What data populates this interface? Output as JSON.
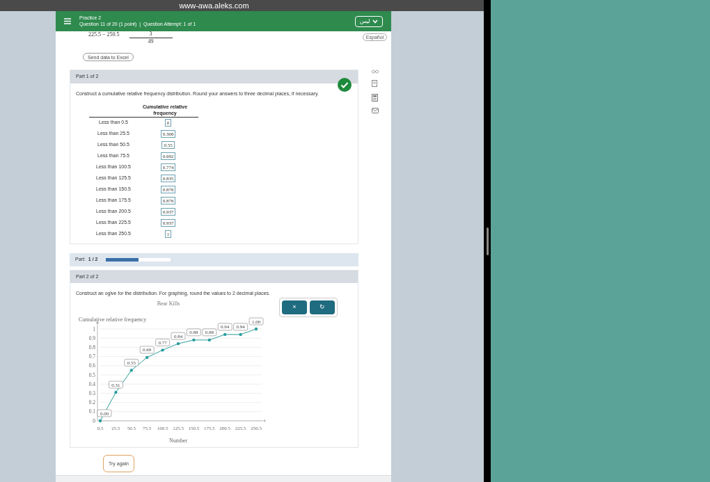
{
  "browser": {
    "url": "www-awa.aleks.com"
  },
  "header": {
    "title": "Practice 2",
    "subtitle": "Question 11 of 20 (1 point)  |  Question Attempt: 1 of 1",
    "language": "ليس"
  },
  "language_button": "Español",
  "previous": {
    "range": "225.5 − 250.5",
    "numerator": "3",
    "denominator": "49"
  },
  "excel_button": "Send data to Excel",
  "part1": {
    "title": "Part 1 of 2",
    "correct": true,
    "instruction": "Construct a cumulative relative frequency distribution. Round your answers to three decimal places, if necessary.",
    "column_header": "Cumulative relative frequency",
    "rows": [
      {
        "label": "Less than 0.5",
        "value": "0"
      },
      {
        "label": "Less than 25.5",
        "value": "0.306"
      },
      {
        "label": "Less than 50.5",
        "value": "0.55"
      },
      {
        "label": "Less than 75.5",
        "value": "0.692"
      },
      {
        "label": "Less than 100.5",
        "value": "0.774"
      },
      {
        "label": "Less than 125.5",
        "value": "0.835"
      },
      {
        "label": "Less than 150.5",
        "value": "0.876"
      },
      {
        "label": "Less than 175.5",
        "value": "0.876"
      },
      {
        "label": "Less than 200.5",
        "value": "0.937"
      },
      {
        "label": "Less than 225.5",
        "value": "0.937"
      },
      {
        "label": "Less than 250.5",
        "value": "1"
      }
    ]
  },
  "progress": {
    "label": "Part:",
    "value": "1 / 2",
    "level": 0.5
  },
  "part2": {
    "title": "Part 2 of 2",
    "instruction": "Construct an ogive for the distribution. For graphing, round the values to 2 decimal places.",
    "tools": [
      "×",
      "↻"
    ],
    "chart_data": {
      "type": "line",
      "title": "Bear Kills",
      "xlabel": "Number",
      "ylabel": "Cumulative relative frequency",
      "categories": [
        "0.5",
        "25.5",
        "50.5",
        "75.5",
        "100.5",
        "125.5",
        "150.5",
        "175.5",
        "200.5",
        "225.5",
        "250.5"
      ],
      "grid": true,
      "series": [
        {
          "color": "#2a9d9d",
          "values": [
            0,
            0.31,
            0.55,
            0.69,
            0.77,
            0.84,
            0.88,
            0.88,
            0.94,
            0.94,
            1
          ]
        }
      ],
      "ylim": [
        0,
        1
      ],
      "yticks": [
        0,
        0.1,
        0.2,
        0.3,
        0.4,
        0.5,
        0.6,
        0.7,
        0.8,
        0.9,
        1
      ],
      "value_labels": [
        "0.00",
        "0.31",
        "0.55",
        "0.69",
        "0.77",
        "0.84",
        "0.88",
        "0.88",
        "0.94",
        "0.94",
        "1.00"
      ]
    }
  },
  "tooltip": "Try again"
}
